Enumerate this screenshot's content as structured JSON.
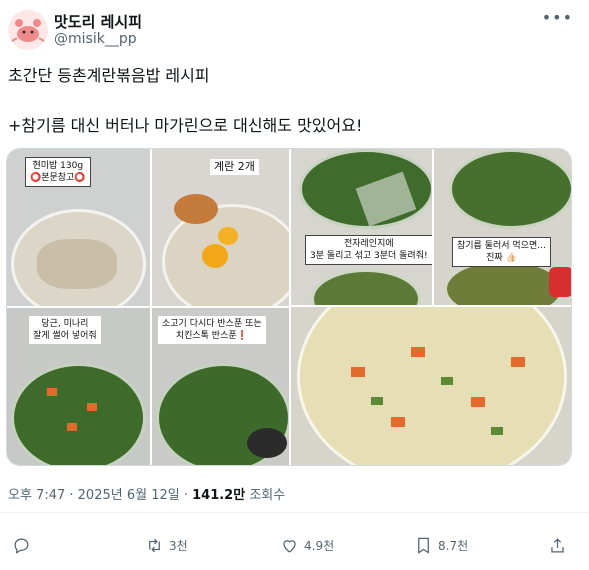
{
  "author": {
    "display_name": "맛도리 레시피",
    "handle": "@misik__pp"
  },
  "post": {
    "line1": "초간단 등촌계란볶음밥 레시피",
    "line2": "+참기름 대신 버터나 마가린으로 대신해도 맛있어요!"
  },
  "media": {
    "p1_caption_line1": "현미밥 130g",
    "p1_caption_line2": "⭕본문참고⭕",
    "p2_caption": "계란 2개",
    "p3_caption_line1": "전자레인지에",
    "p3_caption_line2": "3분 돌리고 섞고 3분더 돌려줘!",
    "p4_caption_line1": "참기름 둘러서 먹으면...",
    "p4_caption_line2": "진짜 👍🏻",
    "p5_caption_line1": "당근, 미나리",
    "p5_caption_line2": "잘게 썰어 넣어줘",
    "p6_caption_line1": "소고기 다시다 반스푼 또는",
    "p6_caption_line2": "치킨스톡 반스푼❗"
  },
  "meta": {
    "time": "오후 7:47",
    "sep1": " · ",
    "date": "2025년 6월 12일",
    "sep2": " · ",
    "views": "141.2만",
    "views_label": " 조회수"
  },
  "actions": {
    "retweets": "3천",
    "likes": "4.9천",
    "bookmarks": "8.7천"
  },
  "colors": {
    "text": "#0f1419",
    "secondary": "#536471",
    "border": "#cfd9de"
  }
}
